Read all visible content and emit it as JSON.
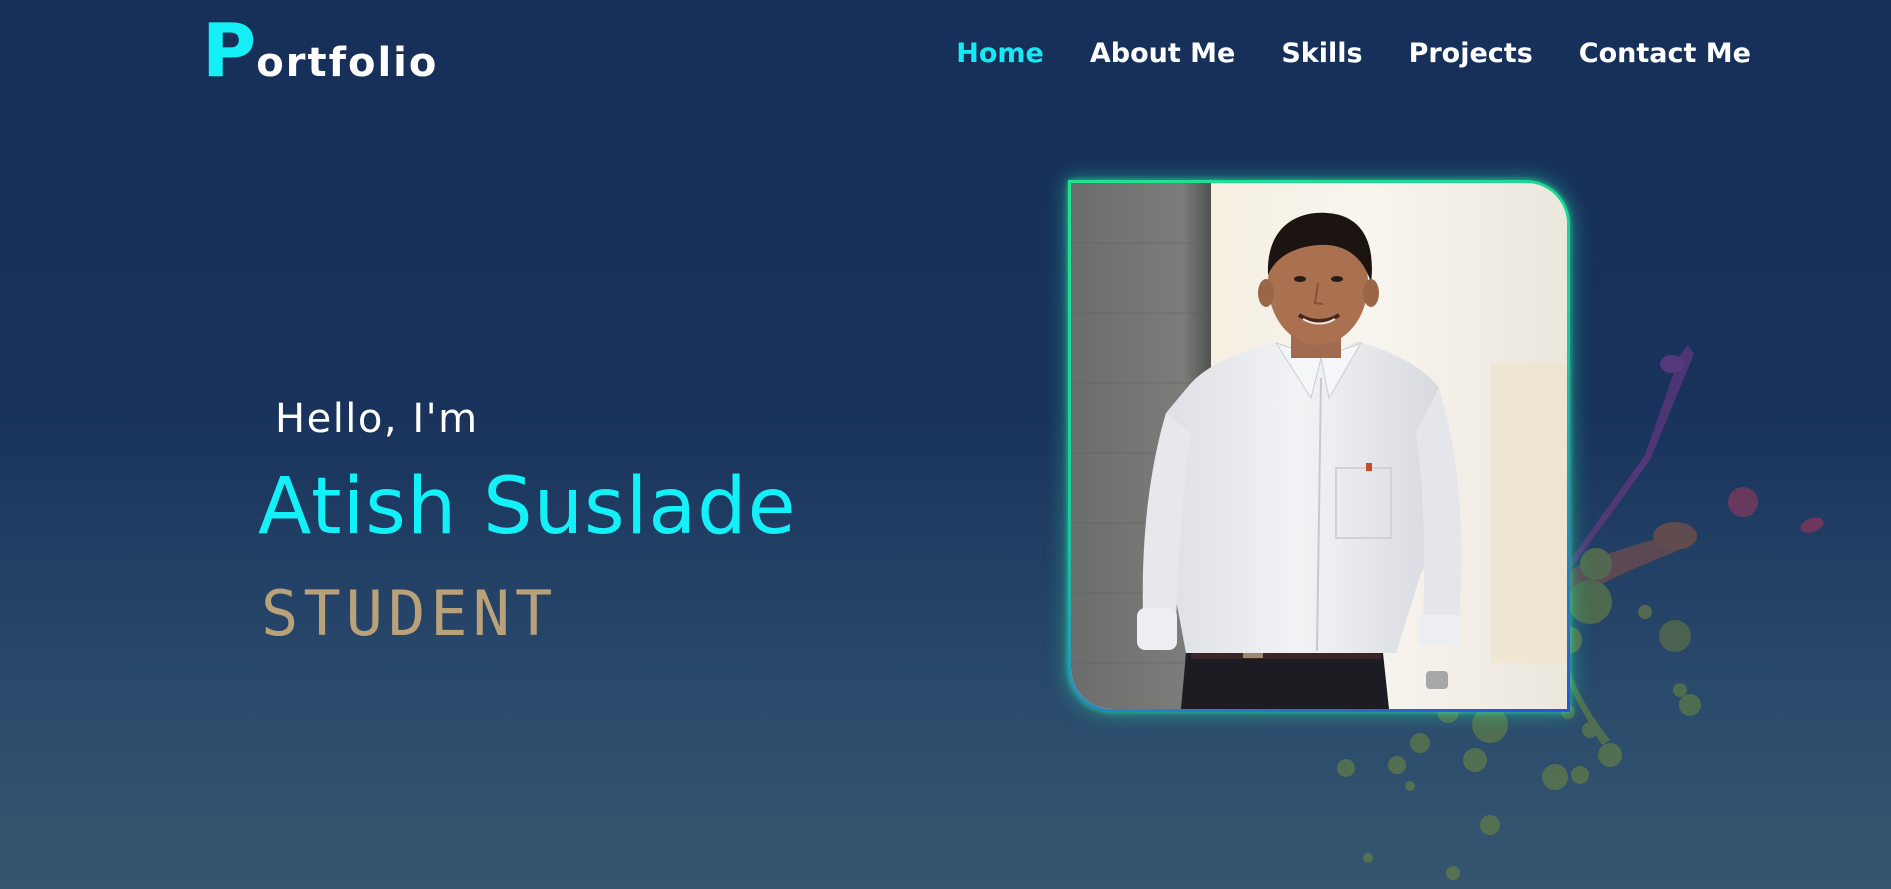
{
  "logo": {
    "initial": "P",
    "rest": "ortfolio"
  },
  "nav": {
    "items": [
      {
        "label": "Home",
        "active": true
      },
      {
        "label": "About Me",
        "active": false
      },
      {
        "label": "Skills",
        "active": false
      },
      {
        "label": "Projects",
        "active": false
      },
      {
        "label": "Contact Me",
        "active": false
      }
    ]
  },
  "hero": {
    "greeting": "Hello, I'm",
    "name": "Atish Suslade",
    "role": "STUDENT"
  },
  "colors": {
    "accent": "#14f0f5",
    "role": "#b9a27a",
    "background_top": "#17305a",
    "background_bottom": "#36566f",
    "frame_border_top": "#21e38f",
    "frame_border_bottom": "#2f4fe0"
  }
}
